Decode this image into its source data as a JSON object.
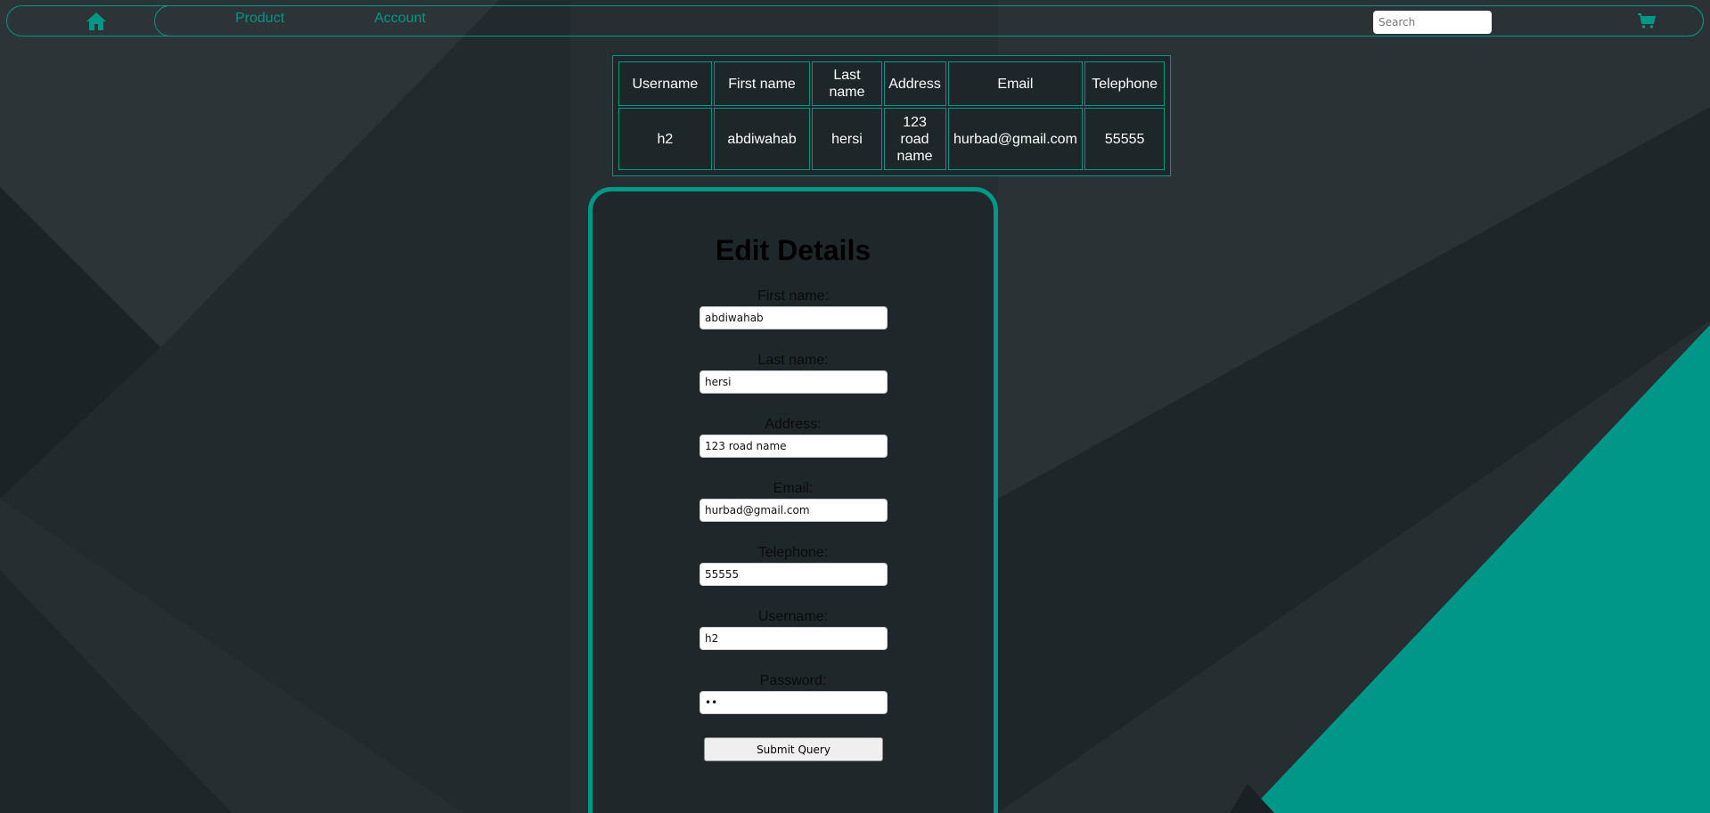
{
  "colors": {
    "accent": "#009688",
    "background": "#262d31",
    "card": "#1e282b"
  },
  "nav": {
    "home_icon": "home-icon",
    "links": [
      {
        "label": "Product"
      },
      {
        "label": "Account"
      }
    ],
    "search_placeholder": "Search",
    "cart_icon": "shopping-cart-icon"
  },
  "table": {
    "headers": [
      "Username",
      "First name",
      "Last name",
      "Address",
      "Email",
      "Telephone"
    ],
    "row": [
      "h2",
      "abdiwahab",
      "hersi",
      "123 road name",
      "hurbad@gmail.com",
      "55555"
    ]
  },
  "form": {
    "title": "Edit Details",
    "fields": [
      {
        "label": "First name:",
        "value": "abdiwahab",
        "type": "text"
      },
      {
        "label": "Last name:",
        "value": "hersi",
        "type": "text"
      },
      {
        "label": "Address:",
        "value": "123 road name",
        "type": "text"
      },
      {
        "label": "Email:",
        "value": "hurbad@gmail.com",
        "type": "text"
      },
      {
        "label": "Telephone:",
        "value": "55555",
        "type": "text"
      },
      {
        "label": "Username:",
        "value": "h2",
        "type": "text"
      },
      {
        "label": "Password:",
        "value": "••",
        "type": "password"
      }
    ],
    "submit_label": "Submit Query"
  }
}
